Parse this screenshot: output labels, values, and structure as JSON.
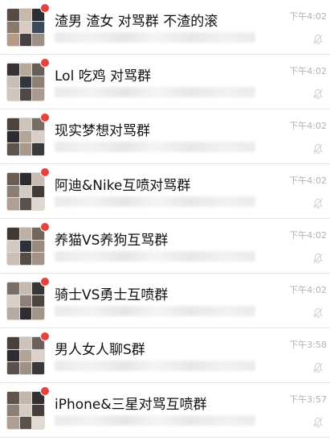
{
  "chats": [
    {
      "title": "渣男 渣女 对骂群 不渣的滚",
      "time": "下午4:02",
      "avatar_colors": [
        "#5b4a42",
        "#c9b9a8",
        "#2e2e35",
        "#8a7a6a",
        "#d8ccc0",
        "#3d4a5c",
        "#b59a88",
        "#474040",
        "#9c8f86"
      ]
    },
    {
      "title": "Lol 吃鸡 对骂群",
      "time": "下午4:02",
      "avatar_colors": [
        "#3a3230",
        "#b8a898",
        "#6a5f58",
        "#c9bdb4",
        "#2f3640",
        "#8f7f74",
        "#d2c6bc",
        "#514845",
        "#a99b90"
      ]
    },
    {
      "title": "现实梦想对骂群",
      "time": "下午4:02",
      "avatar_colors": [
        "#4d433e",
        "#cfc4ba",
        "#7a6d64",
        "#2c2b30",
        "#b4a596",
        "#d9cfc6",
        "#5e544f",
        "#a8988b",
        "#3b3a40"
      ]
    },
    {
      "title": "阿迪&Nike互喷对骂群",
      "time": "下午4:02",
      "avatar_colors": [
        "#6b5d54",
        "#2f2c2e",
        "#c8bbb0",
        "#8b7e75",
        "#d5cbc2",
        "#433b38",
        "#b09f92",
        "#5a504b",
        "#e0d7cf"
      ]
    },
    {
      "title": "养猫VS养狗互骂群",
      "time": "下午4:02",
      "avatar_colors": [
        "#3f3835",
        "#bdb0a5",
        "#74665d",
        "#d3c9c0",
        "#2d3038",
        "#9a8b80",
        "#cbbfb5",
        "#554b47",
        "#a29386"
      ]
    },
    {
      "title": "骑士VS勇士互喷群",
      "time": "下午4:02",
      "avatar_colors": [
        "#7c6e65",
        "#c6b9ae",
        "#3a3634",
        "#d9cfc6",
        "#8e8077",
        "#4c4440",
        "#b8aa9e",
        "#2f2d31",
        "#a49589"
      ]
    },
    {
      "title": "男人女人聊S群",
      "time": "下午3:58",
      "avatar_colors": [
        "#4a413d",
        "#cec3b9",
        "#6d6058",
        "#2e2c30",
        "#b3a497",
        "#dcd2c9",
        "#5b514c",
        "#a09186",
        "#3a383d"
      ]
    },
    {
      "title": "iPhone&三星对骂互喷群",
      "time": "下午3:57",
      "avatar_colors": [
        "#5f534c",
        "#c3b6ab",
        "#353133",
        "#8d7f75",
        "#d6ccc3",
        "#463f3c",
        "#af9f93",
        "#595049",
        "#e2d9d1"
      ]
    }
  ],
  "colors": {
    "badge": "#e64340",
    "title_text": "#111111",
    "time_text": "#b2b2b2",
    "divider": "#e6e6e6"
  }
}
